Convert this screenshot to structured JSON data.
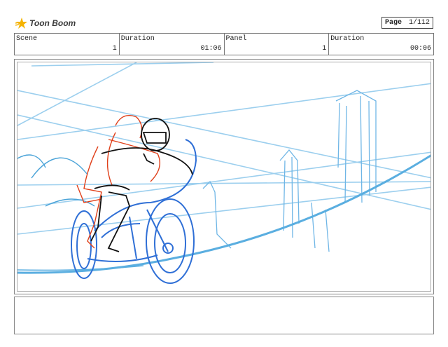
{
  "header": {
    "brand": "Toon Boom",
    "page_label": "Page",
    "page_value": "1/112"
  },
  "info": {
    "scene_label": "Scene",
    "scene_value": "1",
    "scene_duration_label": "Duration",
    "scene_duration_value": "01:06",
    "panel_label": "Panel",
    "panel_value": "1",
    "panel_duration_label": "Duration",
    "panel_duration_value": "00:06"
  },
  "colors": {
    "sky_lines": "#7fc3e8",
    "track": "#5aaee0",
    "bike": "#2f6fd6",
    "rider": "#111111",
    "rough": "#e0401a"
  },
  "notes": {
    "text": ""
  }
}
